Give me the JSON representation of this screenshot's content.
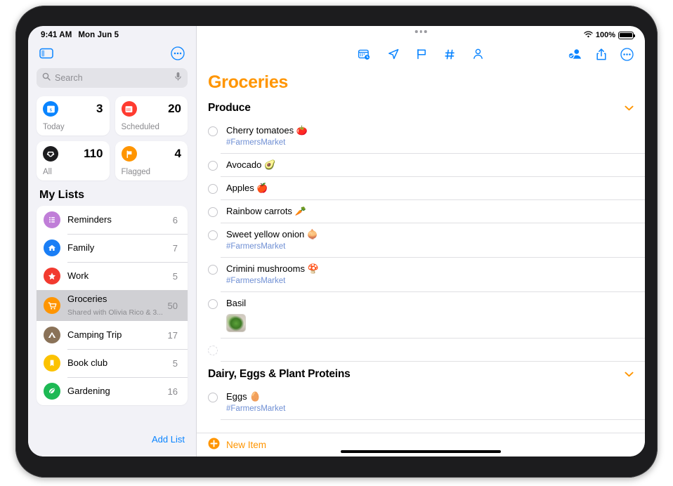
{
  "status_bar": {
    "time": "9:41 AM",
    "date": "Mon Jun 5",
    "wifi_icon": "wifi-icon",
    "battery_percent": "100%"
  },
  "sidebar": {
    "toggle_icon": "sidebar-toggle-icon",
    "more_icon": "more-options-icon",
    "search": {
      "icon": "search-icon",
      "placeholder": "Search",
      "mic_icon": "microphone-icon"
    },
    "smart_lists": [
      {
        "label": "Today",
        "count": "3",
        "icon": "calendar-today-icon",
        "color": "#0a84ff",
        "date_number": "5"
      },
      {
        "label": "Scheduled",
        "count": "20",
        "icon": "calendar-scheduled-icon",
        "color": "#ff3b30"
      },
      {
        "label": "All",
        "count": "110",
        "icon": "all-inbox-icon",
        "color": "#1c1c1e"
      },
      {
        "label": "Flagged",
        "count": "4",
        "icon": "flag-icon",
        "color": "#ff9500"
      }
    ],
    "my_lists_title": "My Lists",
    "lists": [
      {
        "name": "Reminders",
        "subtitle": "",
        "count": "6",
        "icon": "bullet-list-icon",
        "color": "#c07ed8",
        "selected": false
      },
      {
        "name": "Family",
        "subtitle": "",
        "count": "7",
        "icon": "house-icon",
        "color": "#1a7ef5",
        "selected": false
      },
      {
        "name": "Work",
        "subtitle": "",
        "count": "5",
        "icon": "star-icon",
        "color": "#f23a2f",
        "selected": false
      },
      {
        "name": "Groceries",
        "subtitle": "Shared with Olivia Rico & 3...",
        "count": "50",
        "icon": "shopping-cart-icon",
        "color": "#ff9500",
        "selected": true
      },
      {
        "name": "Camping Trip",
        "subtitle": "",
        "count": "17",
        "icon": "tent-icon",
        "color": "#8a7258",
        "selected": false
      },
      {
        "name": "Book club",
        "subtitle": "",
        "count": "5",
        "icon": "bookmark-icon",
        "color": "#fcc породы00",
        "selected": false
      },
      {
        "name": "Gardening",
        "subtitle": "",
        "count": "16",
        "icon": "leaf-icon",
        "color": "#1db954",
        "selected": false
      }
    ],
    "add_list_label": "Add List"
  },
  "main": {
    "toolbar_center": [
      {
        "icon": "calendar-clock-icon",
        "name": "add-date-button"
      },
      {
        "icon": "location-arrow-icon",
        "name": "add-location-button"
      },
      {
        "icon": "flag-icon",
        "name": "flag-button"
      },
      {
        "icon": "hashtag-icon",
        "name": "add-tag-button"
      },
      {
        "icon": "person-icon",
        "name": "assign-person-button"
      }
    ],
    "toolbar_right": [
      {
        "icon": "share-person-icon",
        "name": "collaborate-button"
      },
      {
        "icon": "share-icon",
        "name": "share-button"
      },
      {
        "icon": "more-options-icon",
        "name": "list-options-button"
      }
    ],
    "title": "Groceries",
    "sections": [
      {
        "title": "Produce",
        "collapse_icon": "chevron-down-icon",
        "items": [
          {
            "title": "Cherry tomatoes 🍅",
            "tag": "#FarmersMarket",
            "photo": false
          },
          {
            "title": "Avocado 🥑",
            "tag": "",
            "photo": false
          },
          {
            "title": "Apples 🍎",
            "tag": "",
            "photo": false
          },
          {
            "title": "Rainbow carrots 🥕",
            "tag": "",
            "photo": false
          },
          {
            "title": "Sweet yellow onion 🧅",
            "tag": "#FarmersMarket",
            "photo": false
          },
          {
            "title": "Crimini mushrooms 🍄",
            "tag": "#FarmersMarket",
            "photo": false
          },
          {
            "title": "Basil",
            "tag": "",
            "photo": true
          },
          {
            "title": "",
            "tag": "",
            "photo": false,
            "empty": true
          }
        ]
      },
      {
        "title": "Dairy, Eggs & Plant Proteins",
        "collapse_icon": "chevron-down-icon",
        "items": [
          {
            "title": "Eggs 🥚",
            "tag": "#FarmersMarket",
            "photo": false
          }
        ]
      }
    ],
    "new_item": {
      "icon": "plus-circle-icon",
      "label": "New Item"
    }
  },
  "colors": {
    "accent_orange": "#ff9500",
    "accent_blue": "#0a84ff",
    "tag_blue": "#6f8fd4",
    "sidebar_bg": "#f2f2f7"
  }
}
